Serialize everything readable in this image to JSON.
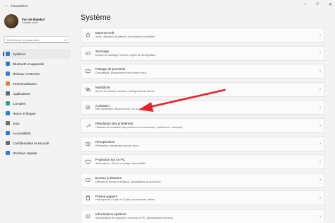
{
  "window": {
    "title": "Paramètres"
  },
  "profile": {
    "name": "Fan de Malekal",
    "subtitle": "Compte local"
  },
  "search": {
    "placeholder": "Rechercher un paramètre"
  },
  "nav": {
    "items": [
      {
        "label": "Système",
        "icon": "monitor-icon",
        "color": "#2b7cd3"
      },
      {
        "label": "Bluetooth et appareils",
        "icon": "bluetooth-icon",
        "color": "#2b7cd3"
      },
      {
        "label": "Réseau et Internet",
        "icon": "network-icon",
        "color": "#3a7bd5"
      },
      {
        "label": "Personnalisation",
        "icon": "brush-icon",
        "color": "#d9823b"
      },
      {
        "label": "Applications",
        "icon": "apps-icon",
        "color": "#5a6b7b"
      },
      {
        "label": "Comptes",
        "icon": "account-icon",
        "color": "#2fa36b"
      },
      {
        "label": "Heure et langue",
        "icon": "clock-icon",
        "color": "#2b7cd3"
      },
      {
        "label": "Jeux",
        "icon": "gamepad-icon",
        "color": "#6b6b6b"
      },
      {
        "label": "Accessibilité",
        "icon": "accessibility-icon",
        "color": "#2b7cd3"
      },
      {
        "label": "Confidentialité et sécurité",
        "icon": "shield-icon",
        "color": "#6b6b6b"
      },
      {
        "label": "Windows Update",
        "icon": "update-icon",
        "color": "#2b7cd3"
      }
    ]
  },
  "main": {
    "title": "Système",
    "cards": [
      {
        "title": "Marche/Arrêt",
        "subtitle": "Veille, utilisation de batterie, économiseur de batterie",
        "icon": "power-icon"
      },
      {
        "title": "Stockage",
        "subtitle": "Espace de stockage, lecteurs, règles de configuration",
        "icon": "storage-icon"
      },
      {
        "title": "Partage de proximité",
        "subtitle": "Détectabilité, emplacement des fichiers reçus",
        "icon": "share-icon"
      },
      {
        "title": "Multitâche",
        "subtitle": "Ancrer les fenêtres, bureaux, changement de tâches",
        "icon": "multitask-icon"
      },
      {
        "title": "Activation",
        "subtitle": "État d'activation, abonnements, clé de produit",
        "icon": "activation-icon"
      },
      {
        "title": "Résolution des problèmes",
        "subtitle": "Utilitaires de résolution des problèmes recommandés, préférences, historique",
        "icon": "troubleshoot-icon"
      },
      {
        "title": "Récupération",
        "subtitle": "Réinitialiser, démarrage avancé, retour",
        "icon": "recovery-icon"
      },
      {
        "title": "Projection sur ce PC",
        "subtitle": "Autorisations, PIN de couplage, détectabilité",
        "icon": "projection-icon"
      },
      {
        "title": "Bureau à distance",
        "subtitle": "Utilisateurs Bureau à distance, autorisations de connexion",
        "icon": "remote-desktop-icon"
      },
      {
        "title": "Presse-papiers",
        "subtitle": "Historique de Couper et Copier, synchroniser, effacer",
        "icon": "clipboard-icon"
      },
      {
        "title": "Informations système",
        "subtitle": "Spécifications de l'appareil, renommer le PC, spécifications Windows",
        "icon": "info-icon"
      }
    ]
  },
  "annotation": {
    "arrow_color": "#e8222a"
  }
}
